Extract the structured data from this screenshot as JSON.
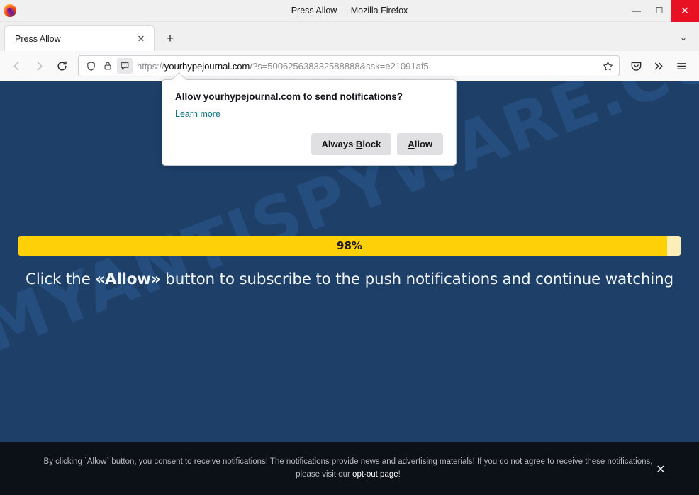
{
  "window": {
    "title": "Press Allow — Mozilla Firefox",
    "minimize_label": "—",
    "maximize_label": "☐",
    "close_label": "✕",
    "logo_name": "firefox-logo"
  },
  "tabs": {
    "items": [
      {
        "label": "Press Allow",
        "close_label": "✕"
      }
    ],
    "new_tab_label": "+",
    "list_all_tabs_label": "⌄"
  },
  "toolbar": {
    "back_label": "←",
    "forward_label": "→",
    "reload_label": "↻",
    "url_prefix": "https://",
    "url_host": "yourhypejournal.com",
    "url_path": "/?s=500625638332588888&ssk=e21091af5",
    "url_full": "https://yourhypejournal.com/?s=500625638332588888&ssk=e21091af5",
    "bookmark_label": "☆",
    "pocket_label": "pocket",
    "overflow_label": "»",
    "menu_label": "≡"
  },
  "permission_dialog": {
    "title": "Allow yourhypejournal.com to send notifications?",
    "learn_more": "Learn more",
    "block_button": {
      "pre": "Always ",
      "accesskey": "B",
      "post": "lock"
    },
    "allow_button": {
      "pre": "",
      "accesskey": "A",
      "post": "llow"
    }
  },
  "page": {
    "watermark": "MYANTISPYWARE.COM",
    "progress": {
      "percent": 98,
      "label": "98%"
    },
    "headline": {
      "before": "Click the ",
      "emphasis": "«Allow»",
      "after": " button to subscribe to the push notifications and continue watching"
    },
    "banner": {
      "text_before": "By clicking `Allow` button, you consent to receive notifications! The notifications provide news and advertising materials! If you do not agree to receive these notifications, please visit our ",
      "link": "opt-out page",
      "text_after": "!",
      "close_label": "✕"
    }
  },
  "colors": {
    "page_background": "#1e4068",
    "progress_fill": "#fdd008",
    "progress_track": "#fbeeb8",
    "banner_background": "#0c1017",
    "close_button": "#e81123",
    "link": "#0a6f84"
  }
}
